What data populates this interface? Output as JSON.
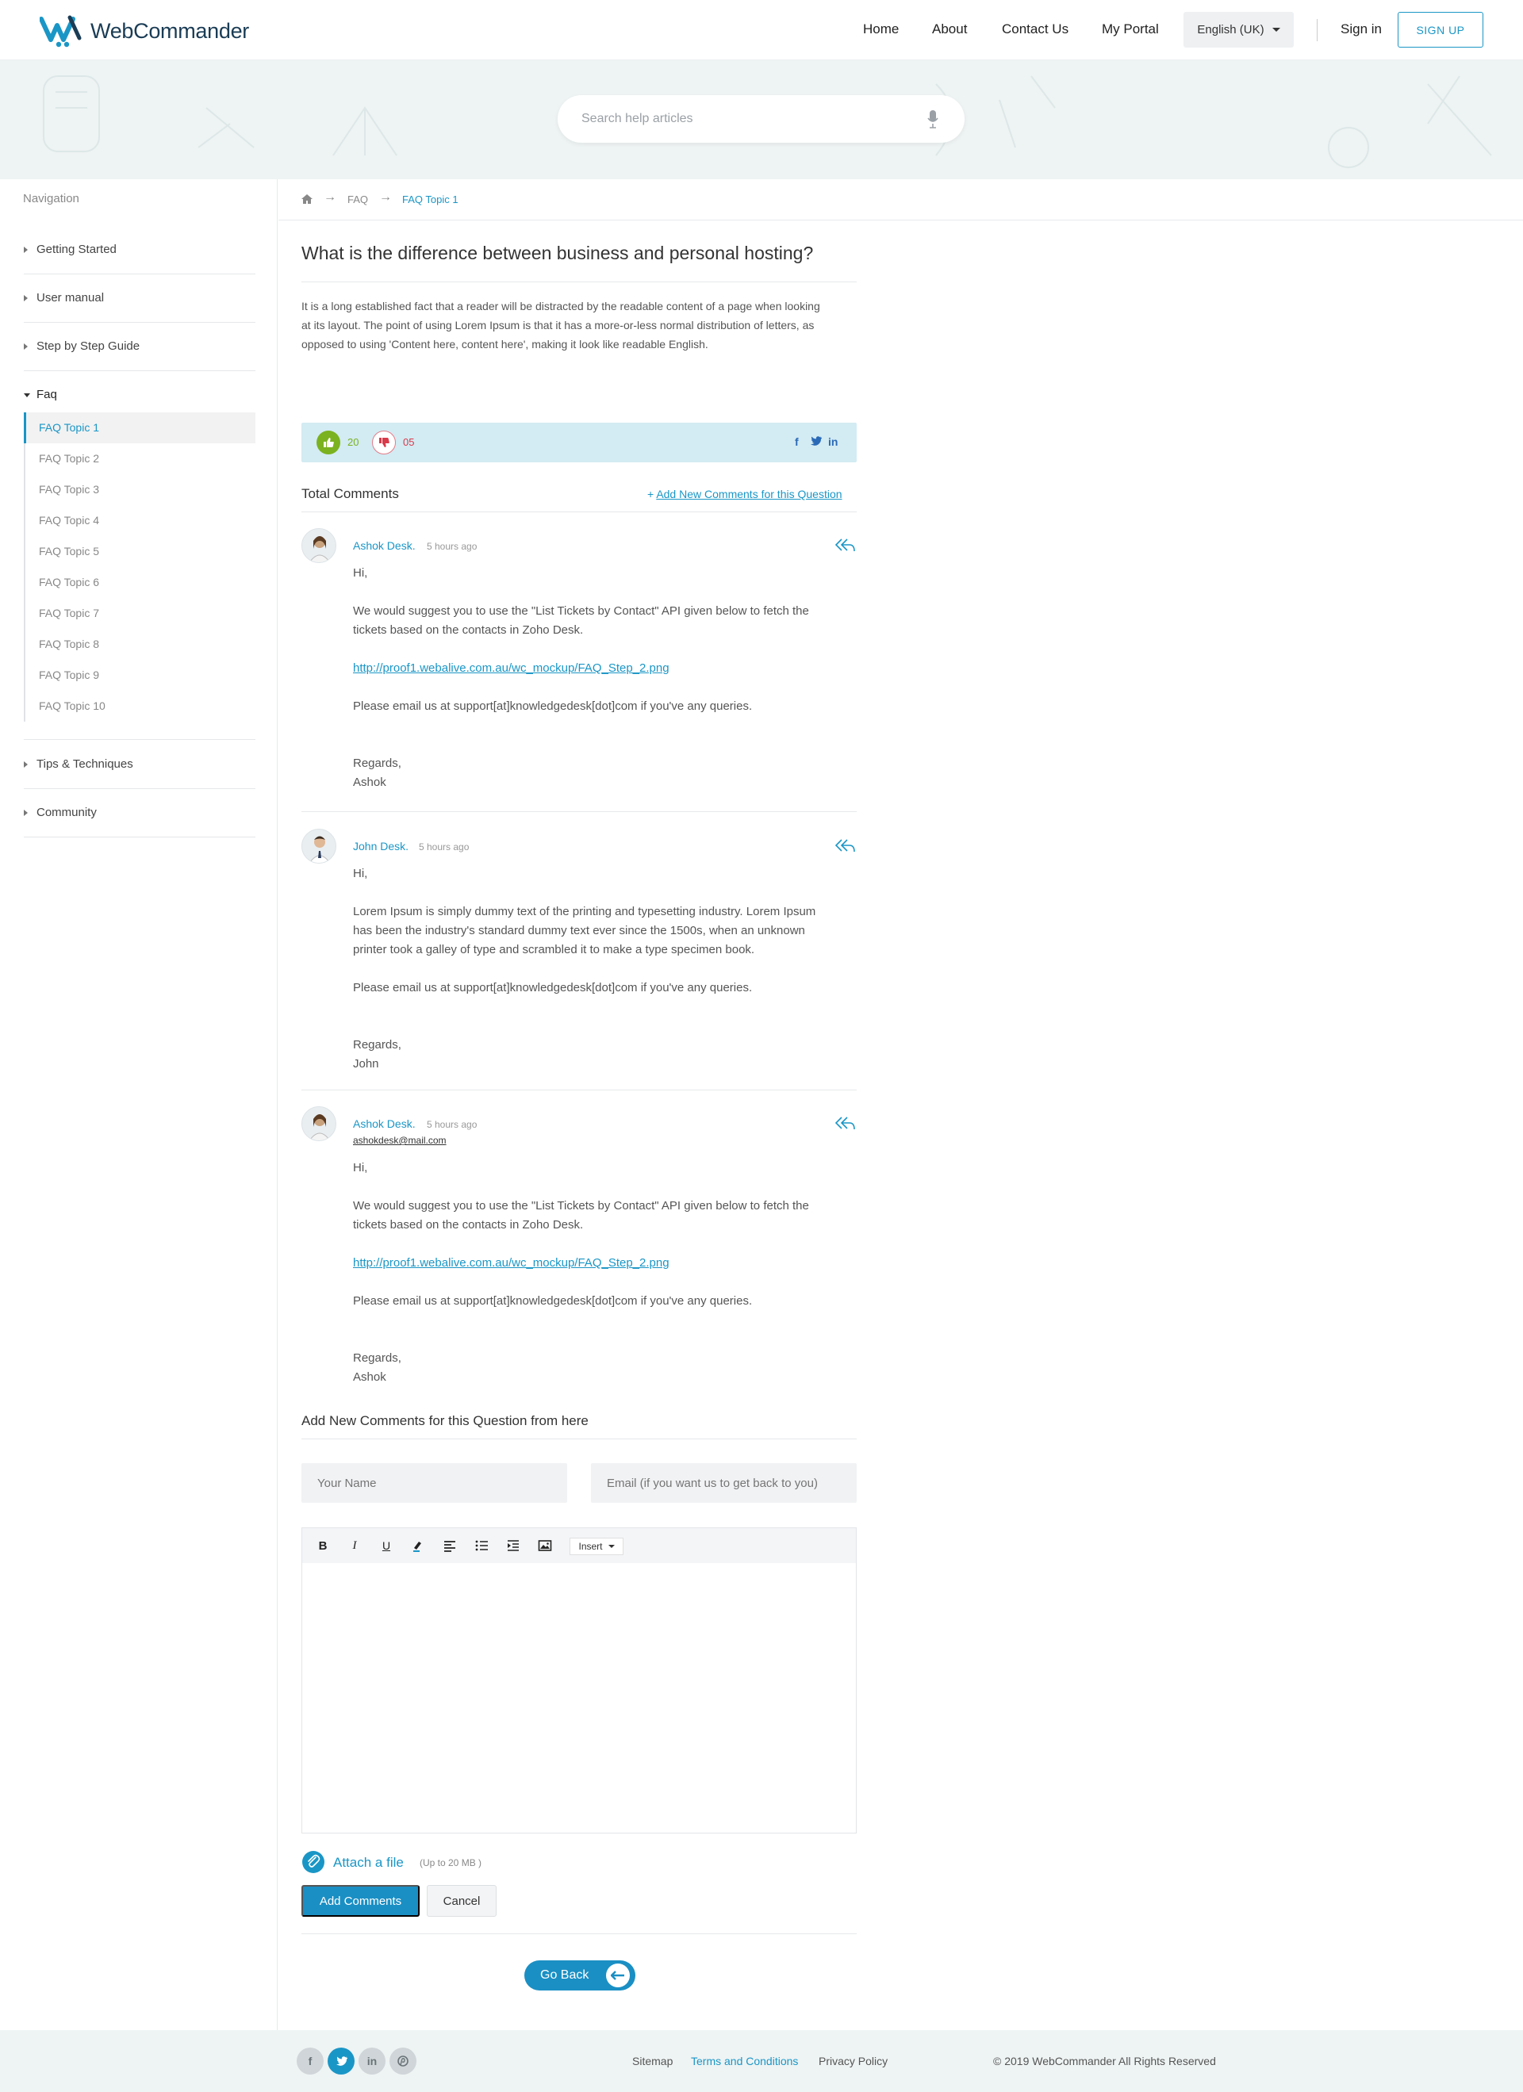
{
  "header": {
    "logo_text": "WebCommander",
    "nav": [
      "Home",
      "About",
      "Contact Us",
      "My Portal"
    ],
    "language": "English (UK)",
    "sign_in": "Sign in",
    "sign_up": "SIGN UP"
  },
  "search": {
    "placeholder": "Search help articles"
  },
  "sidebar": {
    "title": "Navigation",
    "sections": [
      "Getting Started",
      "User manual",
      "Step by Step Guide",
      "Faq",
      "Tips & Techniques",
      "Community"
    ],
    "faq_items": [
      "FAQ Topic 1",
      "FAQ Topic 2",
      "FAQ Topic 3",
      "FAQ Topic 4",
      "FAQ Topic 5",
      "FAQ Topic 6",
      "FAQ Topic 7",
      "FAQ Topic 8",
      "FAQ Topic 9",
      "FAQ Topic 10"
    ],
    "active_item": "FAQ Topic 1"
  },
  "breadcrumb": {
    "items": [
      "FAQ",
      "FAQ Topic 1"
    ],
    "separator": "→"
  },
  "article": {
    "title": "What is the difference between business and personal hosting?",
    "intro": "It is a long established fact that a reader will be distracted by the readable content of a page when looking at its layout. The point of using Lorem Ipsum is that it has a more-or-less normal distribution of letters, as opposed to using 'Content here, content here', making it look like readable English."
  },
  "votes": {
    "up": "20",
    "down": "05"
  },
  "comments_header": {
    "title": "Total Comments",
    "add_plus": "+",
    "add_link": "Add New Comments for this Question"
  },
  "comments": [
    {
      "name": "Ashok Desk.",
      "time": "5 hours ago",
      "greeting": "Hi,",
      "text": "We would suggest you to use the \"List Tickets by Contact\" API given below to fetch the tickets based on the contacts in Zoho Desk.",
      "link": "http://proof1.webalive.com.au/wc_mockup/FAQ_Step_2.png",
      "email_note": "Please email us at support[at]knowledgedesk[dot]com if you've any queries.",
      "regards": "Regards,",
      "signoff": "Ashok"
    },
    {
      "name": "John Desk.",
      "time": "5 hours ago",
      "greeting": "Hi,",
      "text": "Lorem Ipsum is simply dummy text of the printing and typesetting industry. Lorem Ipsum has been the industry's standard dummy text ever since the 1500s, when an unknown printer took a galley of type and scrambled it to make a type specimen book.",
      "email_note": "Please email us at support[at]knowledgedesk[dot]com if you've any queries.",
      "regards": "Regards,",
      "signoff": "John"
    },
    {
      "name": "Ashok Desk.",
      "time": "5 hours ago",
      "email": "ashokdesk@mail.com",
      "greeting": "Hi,",
      "text": "We would suggest you to use the \"List Tickets by Contact\" API given below to fetch the tickets based on the contacts in Zoho Desk.",
      "link": "http://proof1.webalive.com.au/wc_mockup/FAQ_Step_2.png",
      "email_note": "Please email us at support[at]knowledgedesk[dot]com if you've any queries.",
      "regards": "Regards,",
      "signoff": "Ashok"
    }
  ],
  "form": {
    "title": "Add New Comments for this Question from here",
    "name_placeholder": "Your Name",
    "email_placeholder": "Email (if you want us to get back to you)",
    "toolbar": {
      "bold": "B",
      "italic": "I",
      "underline": "U",
      "insert": "Insert"
    },
    "attach_label": "Attach a file",
    "attach_note": "(Up to 20 MB )",
    "submit": "Add Comments",
    "cancel": "Cancel",
    "go_back": "Go Back"
  },
  "footer": {
    "social": [
      "facebook",
      "twitter",
      "linkedin",
      "pinterest"
    ],
    "links": [
      "Sitemap",
      "Terms and Conditions",
      "Privacy Policy"
    ],
    "copyright": "© 2019 WebCommander All Rights Reserved"
  },
  "colors": {
    "accent": "#1a96c6",
    "upvote": "#7bb21f",
    "downvote": "#d83a4a",
    "vote_bar": "#d3ebf3",
    "hero_bg": "#eef3f3"
  }
}
